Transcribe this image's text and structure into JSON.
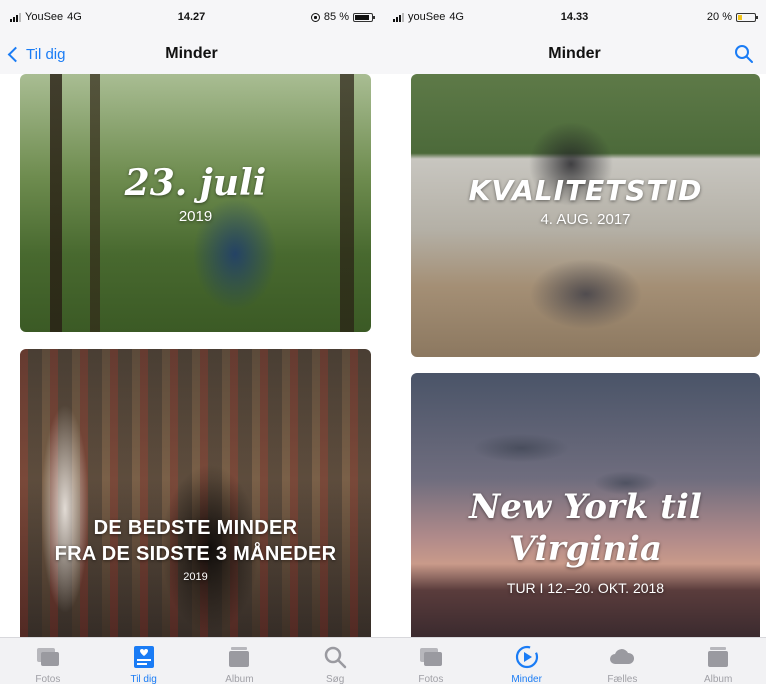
{
  "left": {
    "status": {
      "carrier": "YouSee",
      "network": "4G",
      "time": "14.27",
      "battery": "85 %",
      "battery_level": 0.85
    },
    "nav": {
      "back_label": "Til dig",
      "title": "Minder"
    },
    "cards": [
      {
        "title": "23. juli",
        "subtitle": "2019"
      },
      {
        "title_line1": "DE BEDSTE MINDER",
        "title_line2": "FRA DE SIDSTE 3 MÅNEDER",
        "subtitle": "2019"
      }
    ],
    "tabs": [
      "Fotos",
      "Til dig",
      "Album",
      "Søg"
    ]
  },
  "right": {
    "status": {
      "carrier": "youSee",
      "network": "4G",
      "time": "14.33",
      "battery": "20 %",
      "battery_level": 0.2
    },
    "nav": {
      "title": "Minder"
    },
    "cards": [
      {
        "title": "KVALITETSTID",
        "subtitle": "4. AUG. 2017"
      },
      {
        "title_line1": "New York til",
        "title_line2": "Virginia",
        "subtitle": "TUR I 12.–20. OKT. 2018"
      }
    ],
    "tabs": [
      "Fotos",
      "Minder",
      "Fælles",
      "Album"
    ]
  },
  "colors": {
    "accent": "#1a7cf5",
    "inactive": "#a0a0a6"
  }
}
